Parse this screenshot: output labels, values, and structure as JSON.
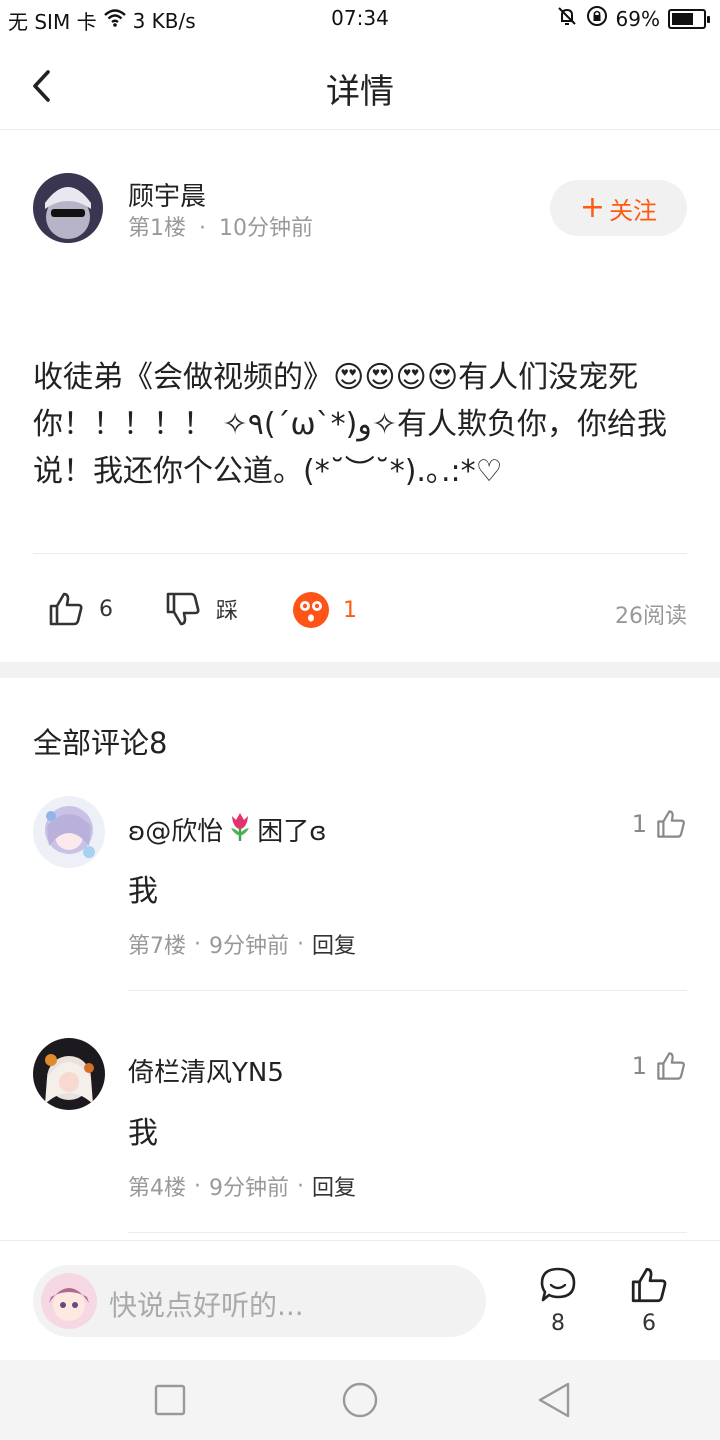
{
  "status_bar": {
    "carrier": "无 SIM 卡",
    "speed": "3 KB/s",
    "time": "07:34",
    "battery": "69%",
    "battery_level": 0.69
  },
  "header": {
    "title": "详情"
  },
  "post": {
    "author": "顾宇晨",
    "floor": "第1楼",
    "dot": "·",
    "time": "10分钟前",
    "follow_label": "关注",
    "content": "收徒弟《会做视频的》😍😍😍😍有人们没宠死你！！！！！ ✧٩(ˊωˋ*)و✧有人欺负你，你给我说！我还你个公道。(*˘︶˘*).｡.:*♡",
    "likes": "6",
    "dislike_label": "踩",
    "reactions": "1",
    "reads": "26阅读"
  },
  "comments_section": {
    "title": "全部评论8",
    "items": [
      {
        "name_prefix": "ʚ@欣怡",
        "name_suffix": "困了ɞ",
        "text": "我",
        "floor": "第7楼",
        "time": "9分钟前",
        "reply": "回复",
        "likes": "1"
      },
      {
        "name_prefix": "倚栏清风YN5",
        "name_suffix": "",
        "text": "我",
        "floor": "第4楼",
        "time": "9分钟前",
        "reply": "回复",
        "likes": "1"
      }
    ]
  },
  "bottom_bar": {
    "input_placeholder": "快说点好听的...",
    "comment_count": "8",
    "like_count": "6"
  },
  "colors": {
    "accent": "#ff5a12",
    "muted": "#999999",
    "divider": "#ececec"
  },
  "icons": {
    "back": "chevron-left-icon",
    "like": "thumbs-up-icon",
    "dislike": "thumbs-down-icon",
    "reaction": "surprised-face-icon",
    "comment": "speech-bubble-icon",
    "nav": [
      "square-recents-icon",
      "circle-home-icon",
      "triangle-back-icon"
    ]
  }
}
